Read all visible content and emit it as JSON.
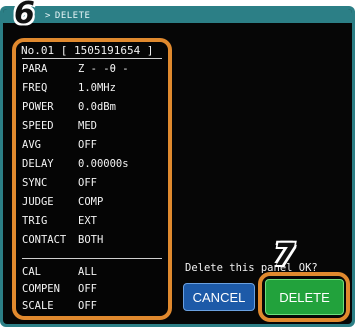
{
  "header": {
    "title": "DELETE"
  },
  "panel": {
    "record_header": "No.01 [ 1505191654 ]",
    "settings": [
      {
        "key": "PARA",
        "value": "Z -  -θ -"
      },
      {
        "key": "FREQ",
        "value": "  1.0MHz"
      },
      {
        "key": "POWER",
        "value": "0.0dBm"
      },
      {
        "key": "SPEED",
        "value": "MED"
      },
      {
        "key": "AVG",
        "value": "OFF"
      },
      {
        "key": "DELAY",
        "value": "0.00000s"
      },
      {
        "key": "SYNC",
        "value": "OFF"
      },
      {
        "key": "JUDGE",
        "value": "COMP"
      },
      {
        "key": "TRIG",
        "value": "EXT"
      },
      {
        "key": "CONTACT",
        "value": "BOTH"
      }
    ],
    "calibration": [
      {
        "key": "CAL",
        "value": "ALL"
      },
      {
        "key": "COMPEN",
        "value": "OFF"
      },
      {
        "key": "SCALE",
        "value": "OFF"
      }
    ]
  },
  "confirm": {
    "prompt": "Delete this panel OK?",
    "cancel_label": "CANCEL",
    "delete_label": "DELETE"
  },
  "callouts": {
    "panel_marker": "6",
    "delete_marker": "7"
  },
  "colors": {
    "frame": "#2c7f86",
    "highlight": "#e0892e",
    "cancel": "#1d5aa8",
    "delete": "#22a23c"
  }
}
